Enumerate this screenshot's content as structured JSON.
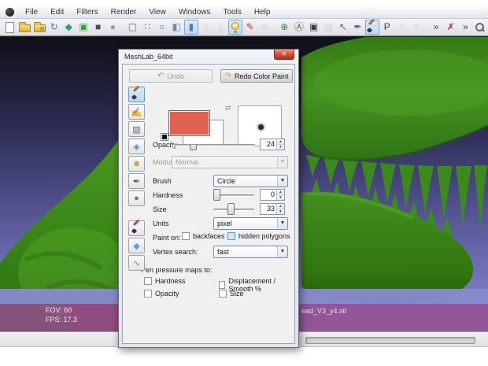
{
  "menu": {
    "items": [
      "File",
      "Edit",
      "Filters",
      "Render",
      "View",
      "Windows",
      "Tools",
      "Help"
    ]
  },
  "toolbar": {
    "icons": [
      {
        "name": "new-project-icon",
        "shape": "page"
      },
      {
        "name": "open-project-icon",
        "shape": "folder"
      },
      {
        "name": "save-project-icon",
        "shape": "folder2"
      },
      {
        "name": "reload-icon",
        "glyph": "↻",
        "color": "#4a7aa8"
      },
      {
        "name": "snapshot-icon",
        "glyph": "◆",
        "color": "#2e9a96"
      },
      {
        "name": "import-image-icon",
        "glyph": "▣",
        "color": "#3f9a3f"
      },
      {
        "name": "cube-icon",
        "glyph": "■",
        "color": "#4a4a55"
      },
      {
        "name": "disc-icon",
        "glyph": "●",
        "color": "#9a9aa2",
        "sep_after": true
      },
      {
        "name": "bbox-render-icon",
        "glyph": "▢",
        "color": "#6a6a72"
      },
      {
        "name": "points-render-icon",
        "glyph": "∷",
        "color": "#6a6a72"
      },
      {
        "name": "wireframe-render-icon",
        "glyph": "○",
        "color": "#6a6a72"
      },
      {
        "name": "flat-shading-icon",
        "glyph": "◧",
        "color": "#7a8ab0"
      },
      {
        "name": "smooth-shading-icon",
        "glyph": "▮",
        "color": "#5577bb",
        "pressed": true
      },
      {
        "name": "texture-a-icon",
        "glyph": "▯",
        "color": "#9999aa",
        "faded": true
      },
      {
        "name": "texture-b-icon",
        "glyph": "▯",
        "color": "#9999aa",
        "faded": true
      },
      {
        "name": "light-icon",
        "shape": "bulb",
        "pressed": true
      },
      {
        "name": "selection-pen-icon",
        "glyph": "✎",
        "color": "#c03030"
      },
      {
        "name": "selection-area-icon",
        "glyph": "◌",
        "color": "#888888",
        "sep_after": true
      },
      {
        "name": "trackball-icon",
        "glyph": "⊕",
        "color": "#3a7a3a"
      },
      {
        "name": "annotation-icon",
        "glyph": "Ⓐ",
        "color": "#555555"
      },
      {
        "name": "shader-icon",
        "glyph": "▣",
        "color": "#3a3a44"
      },
      {
        "name": "layers-icon",
        "glyph": "▤",
        "color": "#9a9aa2",
        "faded": true
      },
      {
        "name": "point-pick-icon",
        "glyph": "↖",
        "color": "#666677"
      },
      {
        "name": "measure-icon",
        "glyph": "✒",
        "color": "#555566"
      },
      {
        "name": "paint-brush-icon",
        "shape": "brush",
        "pressed": true
      },
      {
        "name": "quality-mapper-icon",
        "glyph": "P",
        "color": "#334455"
      },
      {
        "name": "align-a-icon",
        "glyph": "✳",
        "color": "#aaaabb",
        "faded": true
      },
      {
        "name": "align-b-icon",
        "glyph": "✳",
        "color": "#aaaabb",
        "faded": true,
        "sep_after": true
      },
      {
        "name": "overflow-left-icon",
        "glyph": "»",
        "color": "#444444"
      },
      {
        "name": "delete-mesh-icon",
        "glyph": "✗",
        "color": "#cc1f1f"
      },
      {
        "name": "overflow-right-icon",
        "glyph": "»",
        "color": "#444444"
      },
      {
        "name": "search-icon",
        "shape": "zoom"
      }
    ]
  },
  "viewport": {
    "fov": "FOV: 60",
    "fps": "FPS:  17.3",
    "mesh_name": "ead_V3_y4.stl"
  },
  "dialog": {
    "title": "MeshLab_64bit",
    "close_glyph": "✕",
    "undo_label": "Undo",
    "undo_icon": "↶",
    "redo_label": "Redo Color Paint",
    "redo_icon": "↷",
    "tools": [
      {
        "name": "paint-tool-icon",
        "shape": "brush",
        "pressed": true
      },
      {
        "name": "fill-tool-icon",
        "glyph": "✍",
        "color": "#b08040"
      },
      {
        "name": "gradient-tool-icon",
        "glyph": "▧",
        "color": "#666677"
      },
      {
        "name": "clone-tool-icon",
        "glyph": "◈",
        "color": "#4a90d0"
      },
      {
        "name": "stamp-tool-icon",
        "glyph": "☻",
        "color": "#c8a050"
      },
      {
        "name": "pick-color-tool-icon",
        "glyph": "✒",
        "color": "#555566"
      },
      {
        "name": "smooth-sphere-tool-icon",
        "glyph": "●",
        "color": "#777777",
        "gap_after": true
      },
      {
        "name": "mesh-sculpt-tool-icon",
        "shape": "brush-red"
      },
      {
        "name": "water-tool-icon",
        "glyph": "◆",
        "color": "#5aa0e0"
      },
      {
        "name": "smudge-tool-icon",
        "glyph": "∿",
        "color": "#888899"
      }
    ],
    "swap_icon": "⇄",
    "foreground_color": "#e2604e",
    "background_color": "#ffffff",
    "opacity_label": "Opacity",
    "opacity_value": "24",
    "modus_label": "Modus",
    "modus_value": "Normal",
    "brush_label": "Brush",
    "brush_value": "Circle",
    "hardness_label": "Hardness",
    "hardness_value": "0",
    "size_label": "Size",
    "size_value": "33",
    "units_label": "Units",
    "units_value": "pixel",
    "paint_on_label": "Paint on:",
    "backfaces_label": "backfaces",
    "hidden_polygons_label": "hidden polygons",
    "vertex_search_label": "Vertex search:",
    "vertex_search_value": "fast",
    "pen_pressure_label": "Pen pressure maps to:",
    "pen_options": [
      "Hardness",
      "Displacement / Smooth %",
      "Opacity",
      "Size"
    ]
  },
  "colors": {
    "model_green": "#3f8c1c",
    "mouth_brown": "#7c4a26",
    "overlay_magenta": "#944d8f",
    "band_lavender": "#888ace",
    "swatch_red": "#e2604e"
  }
}
